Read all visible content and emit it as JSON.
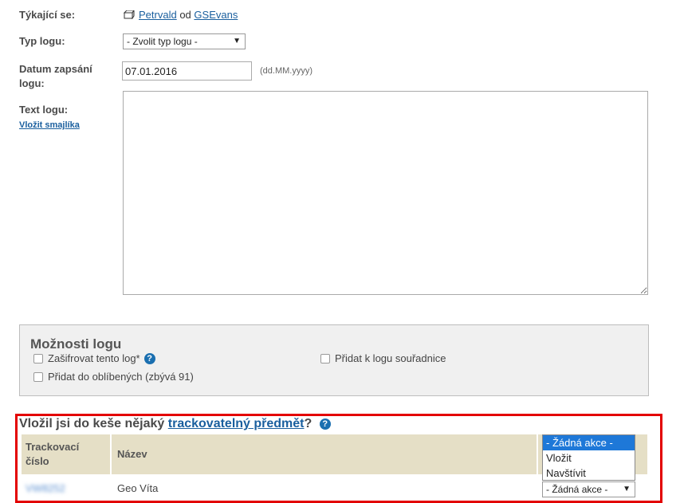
{
  "form": {
    "related_label": "Týkající se:",
    "related_cache": "Petrvald",
    "related_by": "od",
    "related_owner": "GSEvans",
    "type_label": "Typ logu:",
    "type_value": "- Zvolit typ logu -",
    "date_label_1": "Datum zapsání",
    "date_label_2": "logu:",
    "date_value": "07.01.2016",
    "date_hint": "(dd.MM.yyyy)",
    "text_label": "Text logu:",
    "smiley_link": "Vložit smajlíka"
  },
  "options": {
    "title": "Možnosti logu",
    "encrypt": "Zašifrovat tento log*",
    "favorite": "Přidat do oblíbených (zbývá 91)",
    "coords": "Přidat k logu souřadnice"
  },
  "trackables": {
    "title_prefix": "Vložil jsi do keše nějaký",
    "title_link": "trackovatelný předmět",
    "title_suffix": "?",
    "col_number_1": "Trackovací",
    "col_number_2": "číslo",
    "col_name": "Název",
    "row_code": "VW8252",
    "row_name": "Geo Víta",
    "row_action": "- Žádná akce -",
    "dropdown_options": [
      "- Žádná akce -",
      "Vložit",
      "Navštívit"
    ]
  },
  "colors": {
    "link": "#1a5f9e",
    "highlight_frame": "#e30000",
    "table_header": "#e5dfc6",
    "selected_option": "#1e78d8"
  }
}
